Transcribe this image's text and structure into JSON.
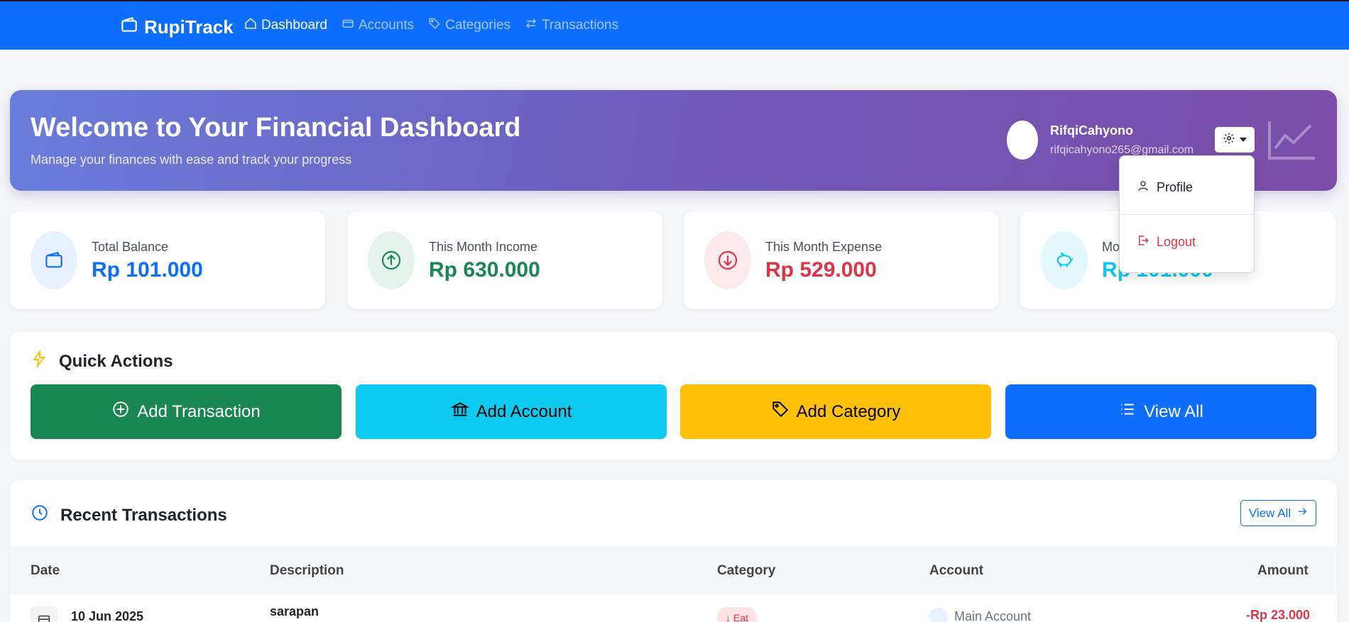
{
  "nav": {
    "brand": "RupiTrack",
    "links": [
      {
        "label": "Dashboard",
        "icon": "home-icon",
        "active": true
      },
      {
        "label": "Accounts",
        "icon": "wallet-icon",
        "active": false
      },
      {
        "label": "Categories",
        "icon": "tags-icon",
        "active": false
      },
      {
        "label": "Transactions",
        "icon": "arrows-icon",
        "active": false
      }
    ]
  },
  "hero": {
    "title": "Welcome to Your Financial Dashboard",
    "subtitle": "Manage your finances with ease and track your progress",
    "user_name": "RifqiCahyono",
    "user_email": "rifqicahyono265@gmail.com"
  },
  "dropdown": {
    "profile_label": "Profile",
    "logout_label": "Logout"
  },
  "stats": [
    {
      "label": "Total Balance",
      "value": "Rp 101.000",
      "color": "#0d6efd",
      "icon": "wallet-icon"
    },
    {
      "label": "This Month Income",
      "value": "Rp 630.000",
      "color": "#198754",
      "icon": "arrow-up-circle-icon"
    },
    {
      "label": "This Month Expense",
      "value": "Rp 529.000",
      "color": "#dc3545",
      "icon": "arrow-down-circle-icon"
    },
    {
      "label": "Mo",
      "value": "Rp 101.000",
      "color": "#0dcaf0",
      "icon": "piggy-bank-icon"
    }
  ],
  "quick_actions": {
    "title": "Quick Actions",
    "buttons": [
      {
        "label": "Add Transaction",
        "color": "#198754",
        "text_color": "#ffffff",
        "icon": "plus-circle-icon"
      },
      {
        "label": "Add Account",
        "color": "#0dcaf0",
        "text_color": "#000000",
        "icon": "bank-icon"
      },
      {
        "label": "Add Category",
        "color": "#ffc107",
        "text_color": "#000000",
        "icon": "tags-icon"
      },
      {
        "label": "View All",
        "color": "#0d6efd",
        "text_color": "#ffffff",
        "icon": "list-icon"
      }
    ]
  },
  "recent": {
    "title": "Recent Transactions",
    "view_all_label": "View All",
    "columns": [
      "Date",
      "Description",
      "Category",
      "Account",
      "Amount"
    ],
    "rows": [
      {
        "date": "10 Jun 2025",
        "description": "sarapan",
        "category": "Eat",
        "account": "Main Account",
        "amount": "-Rp 23.000"
      }
    ]
  }
}
